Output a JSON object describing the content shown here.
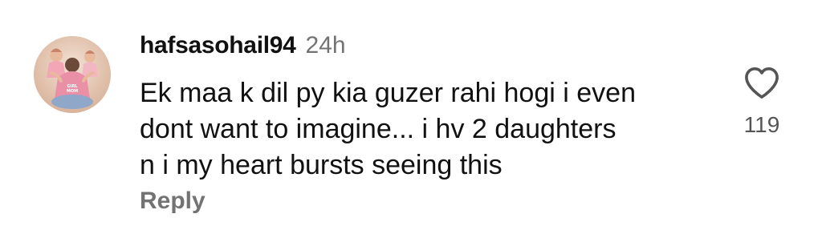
{
  "comment": {
    "username": "hafsasohail94",
    "timestamp": "24h",
    "text_lines": [
      "Ek maa k dil py kia guzer rahi hogi i even",
      "dont want to imagine... i hv 2 daughters",
      "n i my heart bursts seeing this"
    ],
    "reply_label": "Reply",
    "like_count": "119",
    "like_icon": "heart-outline-icon",
    "avatar_caption": "GIRL MOM"
  },
  "colors": {
    "text": "#111111",
    "muted": "#737373",
    "background": "#ffffff"
  }
}
